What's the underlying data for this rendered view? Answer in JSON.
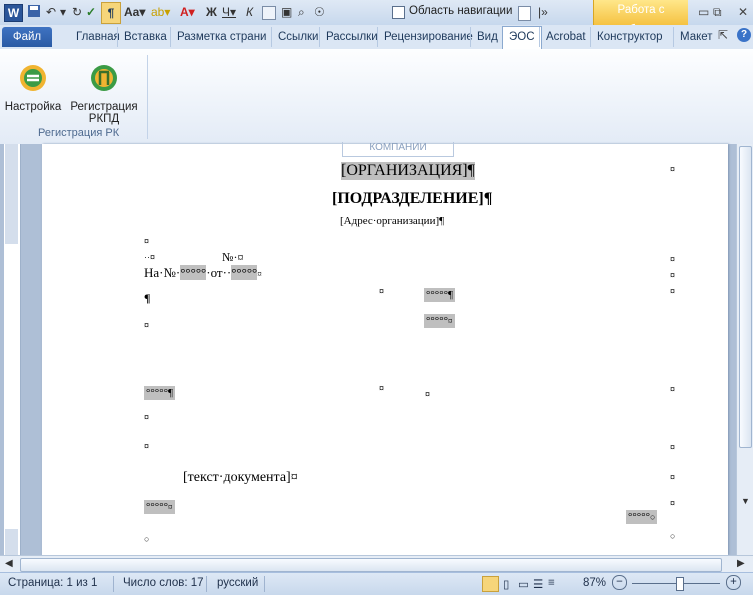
{
  "qat": {
    "nav_pane_label": "Область навигации",
    "context_tab_label": "Работа с таблиц..."
  },
  "tabs": [
    {
      "label": "Файл"
    },
    {
      "label": "Главная"
    },
    {
      "label": "Вставка"
    },
    {
      "label": "Разметка страни"
    },
    {
      "label": "Ссылки"
    },
    {
      "label": "Рассылки"
    },
    {
      "label": "Рецензирование"
    },
    {
      "label": "Вид"
    },
    {
      "label": "ЭОС"
    },
    {
      "label": "Acrobat"
    },
    {
      "label": "Конструктор"
    },
    {
      "label": "Макет"
    }
  ],
  "ribbon": {
    "settings_label": "Настройка",
    "register_label_1": "Регистрация",
    "register_label_2": "РКПД",
    "group_label": "Регистрация РК"
  },
  "document": {
    "logo_text": "КОМПАНИИ",
    "org": "[ОРГАНИЗАЦИЯ]¶",
    "dept": "[ПОДРАЗДЕЛЕНИЕ]¶",
    "address": "[Адрес·организации]¶",
    "num_label": "№·¤",
    "na_label": "На·№·",
    "ot_label": "·от··",
    "field": "°°°°°",
    "body": "[текст·документа]¤"
  },
  "status": {
    "page": "Страница: 1 из 1",
    "words": "Число слов: 17",
    "lang": "русский",
    "zoom": "87%"
  },
  "colors": {
    "accent": "#2a5aa4",
    "context_tab": "#f5c242"
  }
}
